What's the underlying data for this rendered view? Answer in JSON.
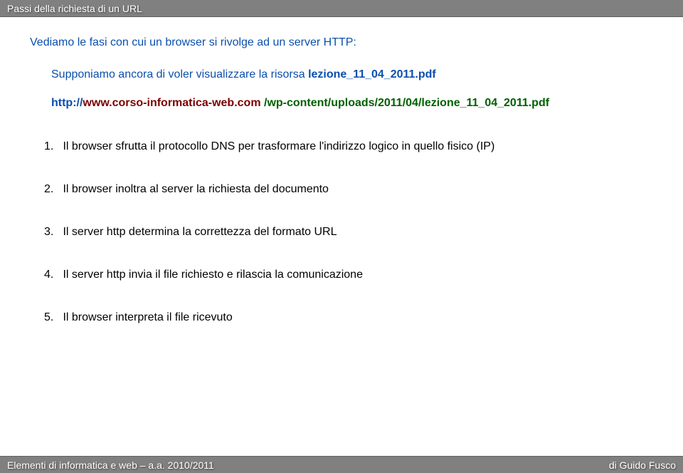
{
  "header": {
    "title": "Passi della richiesta di un URL"
  },
  "intro": {
    "line1": "Vediamo le fasi con cui un browser si rivolge ad un server HTTP:",
    "line2_prefix": "Supponiamo ancora di voler visualizzare la risorsa ",
    "line2_filename": "lezione_11_04_2011.pdf"
  },
  "url": {
    "protocol": "http://",
    "domain": "www.corso-informatica-web.com",
    "path_sep": " /",
    "path": "wp-content/uploads/2011/04/lezione_11_04_2011.pdf"
  },
  "steps": {
    "s1_num": "1.",
    "s1_text": "Il browser sfrutta il protocollo DNS per trasformare l'indirizzo logico in quello fisico (IP)",
    "s2_num": "2.",
    "s2_text": "Il browser inoltra al server la richiesta del documento",
    "s3_num": "3.",
    "s3_text": "Il server http determina la correttezza del formato URL",
    "s4_num": "4.",
    "s4_text": "Il server http invia il file richiesto e rilascia la comunicazione",
    "s5_num": "5.",
    "s5_text": "Il browser interpreta il file ricevuto"
  },
  "footer": {
    "left": "Elementi di informatica e web – a.a. 2010/2011",
    "right": "di Guido Fusco"
  }
}
